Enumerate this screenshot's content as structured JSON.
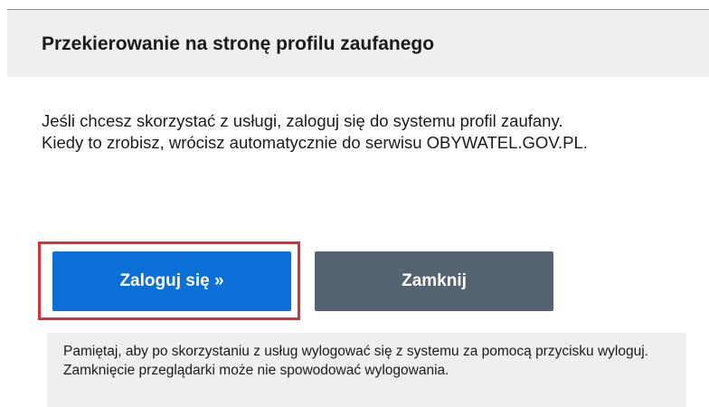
{
  "dialog": {
    "title": "Przekierowanie na stronę profilu zaufanego",
    "message_line1": "Jeśli chcesz skorzystać z usługi, zaloguj się do systemu profil zaufany.",
    "message_line2": "Kiedy to zrobisz, wrócisz automatycznie do serwisu OBYWATEL.GOV.PL.",
    "login_button_label": "Zaloguj się »",
    "close_button_label": "Zamknij",
    "notice_text": "Pamiętaj, aby po skorzystaniu z usług wylogować się z systemu za pomocą przycisku wyloguj. Zamknięcie przeglądarki może nie spowodować wylogowania."
  },
  "colors": {
    "primary_button": "#0a6fd6",
    "secondary_button": "#556271",
    "focus_outline": "#d6303a",
    "panel_background": "#efefef"
  }
}
